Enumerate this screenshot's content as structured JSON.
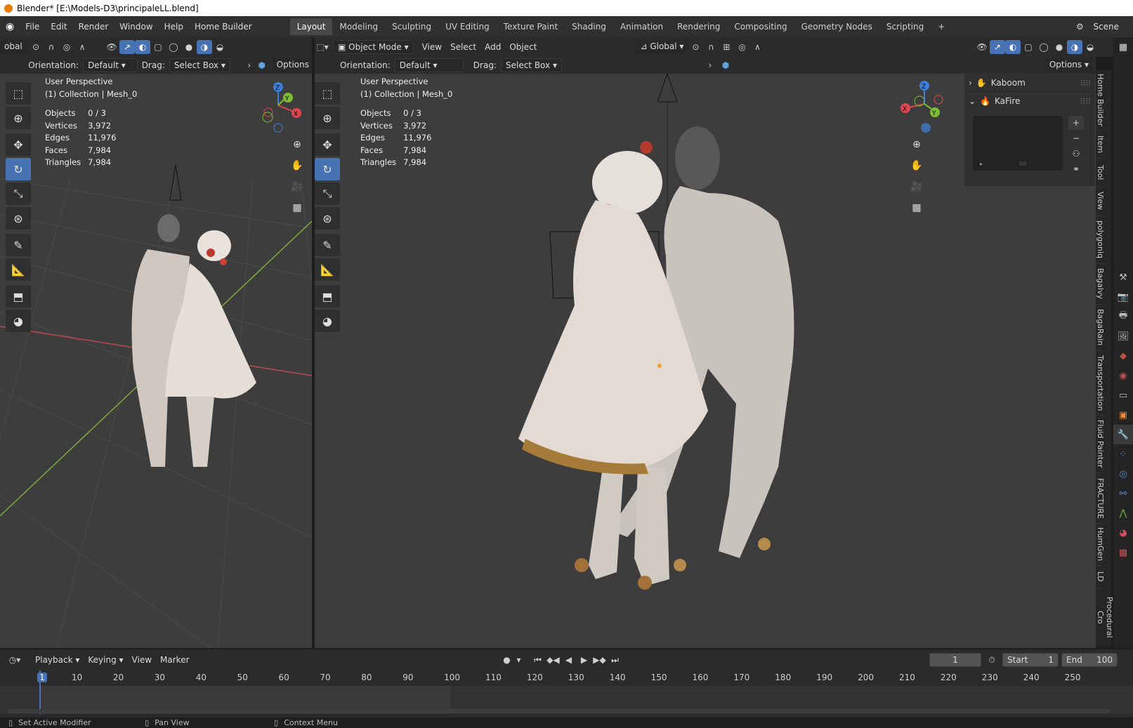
{
  "window_title": "Blender* [E:\\Models-D3\\principaleLL.blend]",
  "menu": [
    "File",
    "Edit",
    "Render",
    "Window",
    "Help",
    "Home Builder"
  ],
  "workspaces": [
    "Layout",
    "Modeling",
    "Sculpting",
    "UV Editing",
    "Texture Paint",
    "Shading",
    "Animation",
    "Rendering",
    "Compositing",
    "Geometry Nodes",
    "Scripting"
  ],
  "active_workspace": "Layout",
  "scene_label": "Scene",
  "left_view": {
    "transform_label": "obal",
    "orientation_label": "Orientation:",
    "orientation_value": "Default",
    "drag_label": "Drag:",
    "drag_value": "Select Box",
    "options_label": "Options",
    "perspective": "User Perspective",
    "collection": "(1) Collection | Mesh_0",
    "stats": [
      {
        "label": "Objects",
        "value": "0 / 3"
      },
      {
        "label": "Vertices",
        "value": "3,972"
      },
      {
        "label": "Edges",
        "value": "11,976"
      },
      {
        "label": "Faces",
        "value": "7,984"
      },
      {
        "label": "Triangles",
        "value": "7,984"
      }
    ]
  },
  "right_view": {
    "mode": "Object Mode",
    "menus": [
      "View",
      "Select",
      "Add",
      "Object"
    ],
    "transform": "Global",
    "orientation_label": "Orientation:",
    "orientation_value": "Default",
    "drag_label": "Drag:",
    "drag_value": "Select Box",
    "options_label": "Options",
    "perspective": "User Perspective",
    "collection": "(1) Collection | Mesh_0",
    "stats": [
      {
        "label": "Objects",
        "value": "0 / 3"
      },
      {
        "label": "Vertices",
        "value": "3,972"
      },
      {
        "label": "Edges",
        "value": "11,976"
      },
      {
        "label": "Faces",
        "value": "7,984"
      },
      {
        "label": "Triangles",
        "value": "7,984"
      }
    ]
  },
  "n_panel": {
    "items": [
      {
        "label": "Kaboom",
        "icon": "hand-icon"
      },
      {
        "label": "KaFire",
        "icon": "fire-icon"
      }
    ]
  },
  "side_tabs": [
    "Home Builder",
    "Item",
    "Tool",
    "View",
    "polygoniq",
    "Bagalvy",
    "BagaRain",
    "Transportation",
    "Fluid Painter",
    "FRACTURE",
    "HumGen",
    "LD",
    "Procedural Cro"
  ],
  "axes": {
    "x": "X",
    "y": "Y",
    "z": "Z"
  },
  "timeline": {
    "menus": [
      "Playback",
      "Keying",
      "View",
      "Marker"
    ],
    "current_frame": "1",
    "start_label": "Start",
    "start_value": "1",
    "end_label": "End",
    "end_value": "100",
    "ruler": [
      "1",
      "10",
      "20",
      "30",
      "40",
      "50",
      "60",
      "70",
      "80",
      "90",
      "100",
      "110",
      "120",
      "130",
      "140",
      "150",
      "160",
      "170",
      "180",
      "190",
      "200",
      "210",
      "220",
      "230",
      "240",
      "250"
    ]
  },
  "status": [
    {
      "label": "Set Active Modifier"
    },
    {
      "label": "Pan View"
    },
    {
      "label": "Context Menu"
    }
  ],
  "colors": {
    "accent": "#4772b3",
    "x_axis": "#e0464f",
    "y_axis": "#7cbd33",
    "z_axis": "#3d80d6"
  }
}
